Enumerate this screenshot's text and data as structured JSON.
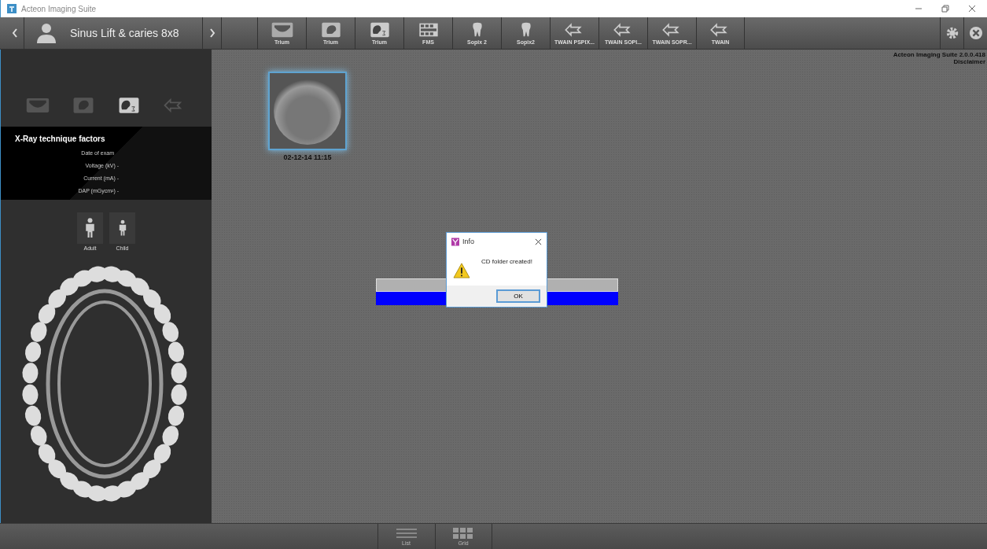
{
  "window": {
    "title": "Acteon Imaging Suite"
  },
  "patient": {
    "name": "Sinus Lift & caries 8x8"
  },
  "devices": [
    {
      "label": "Trium",
      "kind": "pano"
    },
    {
      "label": "Trium",
      "kind": "ceph"
    },
    {
      "label": "Trium",
      "kind": "cbct"
    },
    {
      "label": "FMS",
      "kind": "fms"
    },
    {
      "label": "Sopix 2",
      "kind": "tooth"
    },
    {
      "label": "Sopix2",
      "kind": "tooth"
    },
    {
      "label": "TWAIN PSPIX...",
      "kind": "twain"
    },
    {
      "label": "TWAIN SOPI...",
      "kind": "twain"
    },
    {
      "label": "TWAIN SOPR...",
      "kind": "twain"
    },
    {
      "label": "TWAIN",
      "kind": "twain"
    }
  ],
  "modalities": [
    {
      "kind": "pano",
      "selected": false
    },
    {
      "kind": "ceph",
      "selected": false
    },
    {
      "kind": "cbct",
      "selected": true
    },
    {
      "kind": "twain",
      "selected": false
    }
  ],
  "technique": {
    "title": "X-Ray technique factors",
    "rows": [
      {
        "label": "Date of exam"
      },
      {
        "label": "Voltage (kV) -"
      },
      {
        "label": "Current (mA) -"
      },
      {
        "label": "DAP (mGycm²) -"
      }
    ]
  },
  "patient_types": [
    {
      "label": "Adult"
    },
    {
      "label": "Child"
    }
  ],
  "version": {
    "text": "Acteon Imaging Suite 2.0.0.418",
    "link": "Disclaimer"
  },
  "images": [
    {
      "caption": "02-12-14 11:15"
    }
  ],
  "progress": {
    "level": 1
  },
  "dialog": {
    "title": "Info",
    "message": "CD folder created!",
    "button": "OK"
  },
  "views": [
    {
      "label": "List",
      "kind": "list"
    },
    {
      "label": "Grid",
      "kind": "grid"
    }
  ]
}
